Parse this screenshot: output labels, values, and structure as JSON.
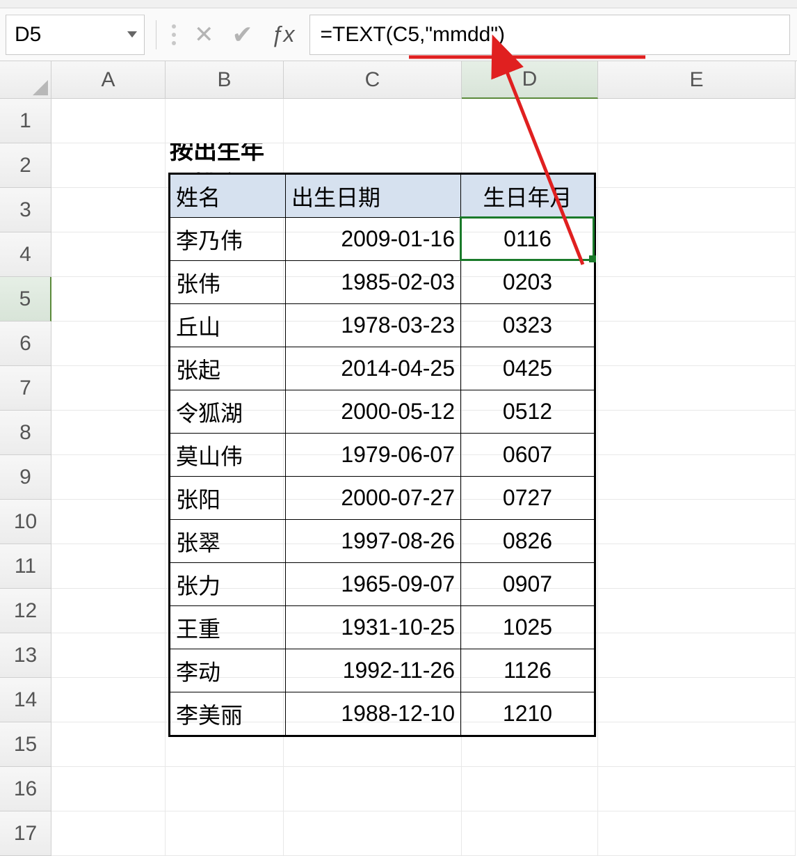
{
  "name_box": "D5",
  "formula": "=TEXT(C5,\"mmdd\")",
  "columns": [
    "A",
    "B",
    "C",
    "D",
    "E"
  ],
  "selected_col": "D",
  "selected_row": 5,
  "row_count": 17,
  "title": "按出生年月排序",
  "table": {
    "headers": [
      "姓名",
      "出生日期",
      "生日年月"
    ],
    "rows": [
      {
        "name": "李乃伟",
        "date": "2009-01-16",
        "mmdd": "0116"
      },
      {
        "name": "张伟",
        "date": "1985-02-03",
        "mmdd": "0203"
      },
      {
        "name": "丘山",
        "date": "1978-03-23",
        "mmdd": "0323"
      },
      {
        "name": "张起",
        "date": "2014-04-25",
        "mmdd": "0425"
      },
      {
        "name": "令狐湖",
        "date": "2000-05-12",
        "mmdd": "0512"
      },
      {
        "name": "莫山伟",
        "date": "1979-06-07",
        "mmdd": "0607"
      },
      {
        "name": "张阳",
        "date": "2000-07-27",
        "mmdd": "0727"
      },
      {
        "name": "张翠",
        "date": "1997-08-26",
        "mmdd": "0826"
      },
      {
        "name": "张力",
        "date": "1965-09-07",
        "mmdd": "0907"
      },
      {
        "name": "王重",
        "date": "1931-10-25",
        "mmdd": "1025"
      },
      {
        "name": "李动",
        "date": "1992-11-26",
        "mmdd": "1126"
      },
      {
        "name": "李美丽",
        "date": "1988-12-10",
        "mmdd": "1210"
      }
    ]
  }
}
